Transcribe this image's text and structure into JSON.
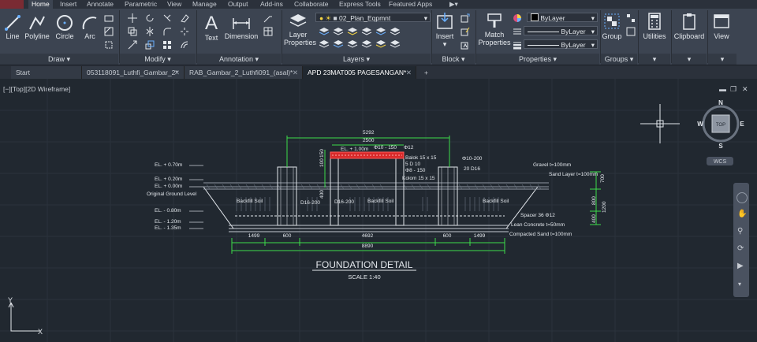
{
  "menu": {
    "tabs": [
      "Home",
      "Insert",
      "Annotate",
      "Parametric",
      "View",
      "Manage",
      "Output",
      "Add-ins",
      "Collaborate",
      "Express Tools",
      "Featured Apps"
    ]
  },
  "ribbon": {
    "draw": {
      "line": "Line",
      "polyline": "Polyline",
      "circle": "Circle",
      "arc": "Arc",
      "title": "Draw"
    },
    "modify": {
      "title": "Modify"
    },
    "annotation": {
      "text": "Text",
      "dimension": "Dimension",
      "title": "Annotation"
    },
    "layers": {
      "layer_properties": "Layer Properties",
      "current_layer": "02_Plan_Eqpmnt",
      "title": "Layers"
    },
    "block": {
      "insert": "Insert",
      "title": "Block"
    },
    "properties": {
      "match": "Match Properties",
      "color": "ByLayer",
      "linetype": "ByLayer",
      "lineweight": "ByLayer",
      "title": "Properties"
    },
    "groups": {
      "group": "Group",
      "title": "Groups"
    },
    "utilities": {
      "label": "Utilities"
    },
    "clipboard": {
      "label": "Clipboard"
    },
    "view": {
      "label": "View"
    }
  },
  "doc_tabs": [
    "Start",
    "053118091_Luthfi_Gambar_2*",
    "RAB_Gambar_2_Luthfi091_(asal)*",
    "APD 23MAT005 PAGESANGAN*"
  ],
  "viewport": {
    "label": "[−][Top][2D Wireframe]"
  },
  "viewcube": {
    "n": "N",
    "s": "S",
    "e": "E",
    "w": "W",
    "top": "TOP",
    "wcs": "WCS"
  },
  "ucs": {
    "x": "X",
    "y": "Y"
  },
  "drawing": {
    "title": "FOUNDATION DETAIL",
    "scale": "SCALE 1:40",
    "levels": [
      "EL. + 0.70m",
      "EL. + 0.20m",
      "EL. + 0.00m",
      "Original Ground Level",
      "EL. - 0.80m",
      "EL. - 1.20m",
      "EL. - 1.35m"
    ],
    "top_el": "EL. + 1.00m",
    "dims_top": [
      "5292",
      "2500",
      "Φ10 - 150",
      "Φ12"
    ],
    "labels_right": [
      "Balok 15 x 15",
      "5 D 10",
      "Φ8 - 150",
      "Kolom 15 x 15",
      "Φ10-200",
      "20 D16"
    ],
    "notes": [
      "Gravel t=100mm",
      "Sand Layer t=100mm",
      "Spacer 36 Φ12",
      "Lean Concrete t=50mm",
      "Compacted Sand t=100mm"
    ],
    "backfill": "Backfill Soil",
    "d16": "D16-200",
    "dims_bottom": [
      "1499",
      "600",
      "4692",
      "600",
      "1499"
    ],
    "total": "8890",
    "vert_dims": [
      "700",
      "800",
      "400",
      "1200"
    ],
    "vert_left": [
      "150",
      "100",
      "400"
    ]
  }
}
